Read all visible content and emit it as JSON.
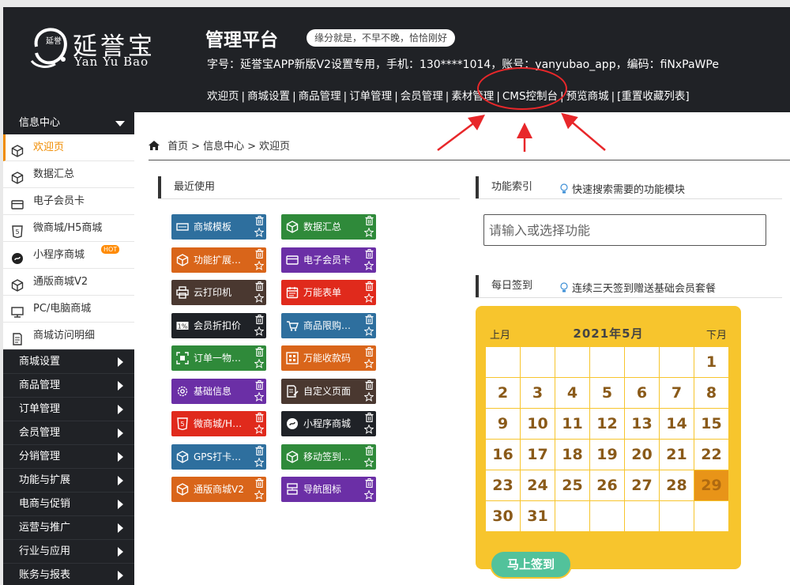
{
  "header": {
    "brand_cn": "延誉宝",
    "brand_en": "Yan Yu Bao",
    "seal_text": "延誉",
    "platform_title": "管理平台",
    "slogan": "缘分就是，不早不晚，恰恰刚好",
    "account_info": "字号：延誉宝APP新版V2设置专用，手机：130****1014，账号：yanyubao_app，编码：fiNxPaWPe",
    "nav": [
      "欢迎页",
      "商城设置",
      "商品管理",
      "订单管理",
      "会员管理",
      "素材管理",
      "CMS控制台",
      "预览商城",
      "[重置收藏列表]"
    ],
    "highlight_color": "#e8272a"
  },
  "sidebar": {
    "group_title": "信息中心",
    "sub_items": [
      {
        "label": "欢迎页",
        "icon": "cube-icon",
        "active": true
      },
      {
        "label": "数据汇总",
        "icon": "cube-icon"
      },
      {
        "label": "电子会员卡",
        "icon": "card-icon"
      },
      {
        "label": "微商城/H5商城",
        "icon": "html5-icon"
      },
      {
        "label": "小程序商城",
        "icon": "miniprogram-icon",
        "badge": "HOT"
      },
      {
        "label": "通版商城V2",
        "icon": "cube-icon"
      },
      {
        "label": "PC/电脑商城",
        "icon": "monitor-icon"
      },
      {
        "label": "商城访问明细",
        "icon": "document-icon"
      }
    ],
    "categories": [
      "商城设置",
      "商品管理",
      "订单管理",
      "会员管理",
      "分销管理",
      "功能与扩展",
      "电商与促销",
      "运营与推广",
      "行业与应用",
      "账务与报表"
    ],
    "accent_color": "#f08c00"
  },
  "breadcrumb": {
    "items": [
      "首页",
      "信息中心",
      "欢迎页"
    ],
    "separator": ">"
  },
  "recent": {
    "title": "最近使用",
    "tiles": [
      {
        "label": "商城模板",
        "color": "#2e6f9e",
        "icon": "shop-template-icon"
      },
      {
        "label": "数据汇总",
        "color": "#2f8a3a",
        "icon": "cube-icon"
      },
      {
        "label": "功能扩展引...",
        "color": "#d9651a",
        "icon": "cube-icon"
      },
      {
        "label": "电子会员卡",
        "color": "#6b2fa6",
        "icon": "card-icon"
      },
      {
        "label": "云打印机",
        "color": "#4a3830",
        "icon": "printer-icon"
      },
      {
        "label": "万能表单",
        "color": "#e02a1c",
        "icon": "calendar-form-icon"
      },
      {
        "label": "会员折扣价",
        "color": "#1f2227",
        "icon": "discount-icon"
      },
      {
        "label": "商品限购商...",
        "color": "#2e6f9e",
        "icon": "cart-icon"
      },
      {
        "label": "订单一物一...",
        "color": "#2f8a3a",
        "icon": "scan-icon"
      },
      {
        "label": "万能收款码",
        "color": "#d9651a",
        "icon": "qrcode-icon"
      },
      {
        "label": "基础信息",
        "color": "#6b2fa6",
        "icon": "gear-icon"
      },
      {
        "label": "自定义页面",
        "color": "#4a3830",
        "icon": "edit-page-icon"
      },
      {
        "label": "微商城/H5...",
        "color": "#e02a1c",
        "icon": "html5-icon"
      },
      {
        "label": "小程序商城",
        "color": "#1f2227",
        "icon": "miniprogram-icon"
      },
      {
        "label": "GPS打卡签...",
        "color": "#2e6f9e",
        "icon": "cube-icon"
      },
      {
        "label": "移动签到（...",
        "color": "#2f8a3a",
        "icon": "cube-icon"
      },
      {
        "label": "通版商城V2",
        "color": "#d9651a",
        "icon": "cube-icon"
      },
      {
        "label": "导航图标",
        "color": "#6b2fa6",
        "icon": "nav-icon"
      }
    ]
  },
  "index": {
    "title": "功能索引",
    "hint": "快速搜索需要的功能模块",
    "search_placeholder": "请输入或选择功能"
  },
  "checkin": {
    "title": "每日签到",
    "hint": "连续三天签到赠送基础会员套餐",
    "prev": "上月",
    "next": "下月",
    "month": "2021年5月",
    "leading_blanks": 6,
    "days": [
      "1",
      "2",
      "3",
      "4",
      "5",
      "6",
      "7",
      "8",
      "9",
      "10",
      "11",
      "12",
      "13",
      "14",
      "15",
      "16",
      "17",
      "18",
      "19",
      "20",
      "21",
      "22",
      "23",
      "24",
      "25",
      "26",
      "27",
      "28",
      "29",
      "30",
      "31"
    ],
    "today": "29",
    "button": "马上签到",
    "calendar_color": "#f7c52d",
    "button_color": "#52c29b"
  }
}
